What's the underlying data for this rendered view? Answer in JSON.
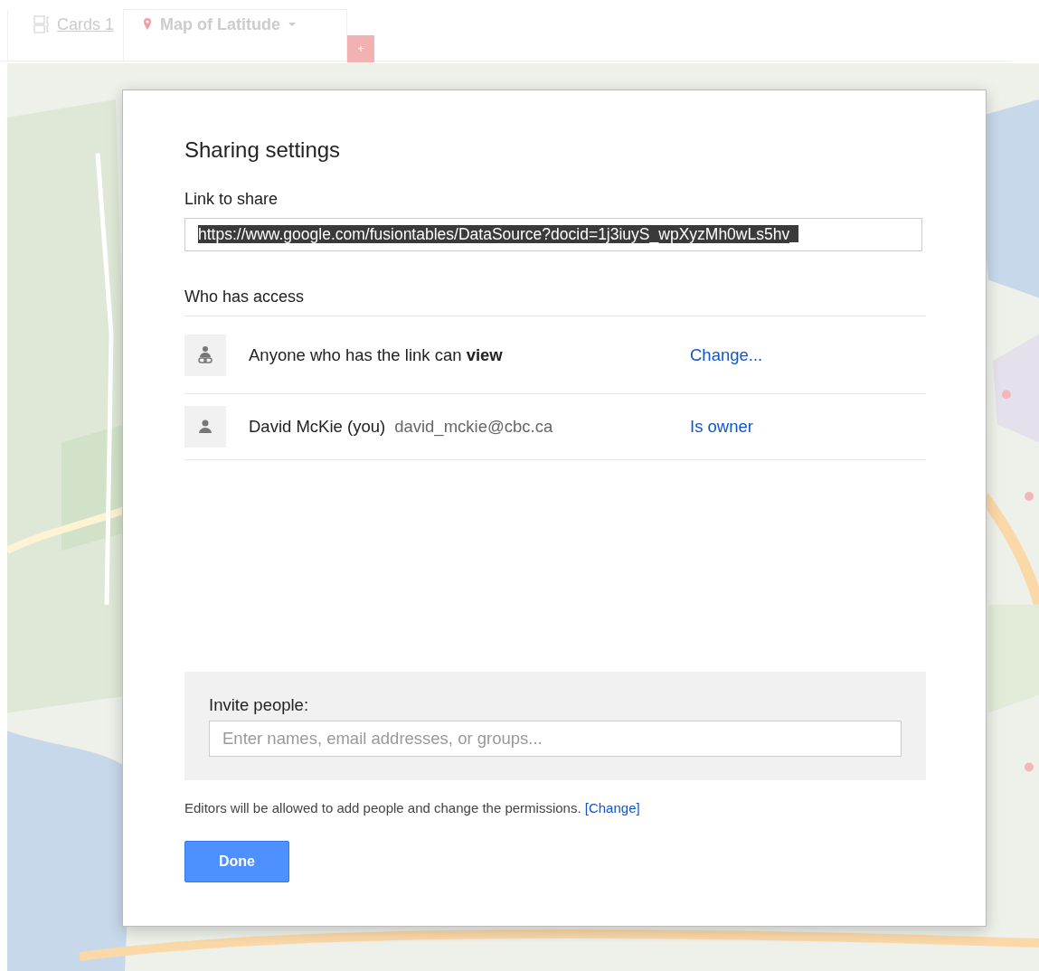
{
  "tabs": [
    {
      "label": "Cards 1",
      "kind": "cards",
      "selected": false
    },
    {
      "label": "Map of Latitude",
      "kind": "map",
      "selected": true
    }
  ],
  "add_tab": {
    "label": "+"
  },
  "dialog": {
    "title": "Sharing settings",
    "link_label": "Link to share",
    "link_value": "https://www.google.com/fusiontables/DataSource?docid=1j3iuyS_wpXyzMh0wLs5hv_",
    "access_heading": "Who has access",
    "access": [
      {
        "kind": "link",
        "text": "Anyone who has the link can **view**",
        "action": "Change..."
      },
      {
        "kind": "person",
        "name": "David McKie (you)",
        "email": "david_mckie@cbc.ca",
        "action": "Is owner"
      }
    ],
    "invite_label": "Invite people:",
    "invite": {
      "placeholder": "Enter names, email addresses, or groups..."
    },
    "note": "Editors will be allowed to add people and change the permissions.",
    "note_link": "[Change]",
    "done": "Done"
  }
}
